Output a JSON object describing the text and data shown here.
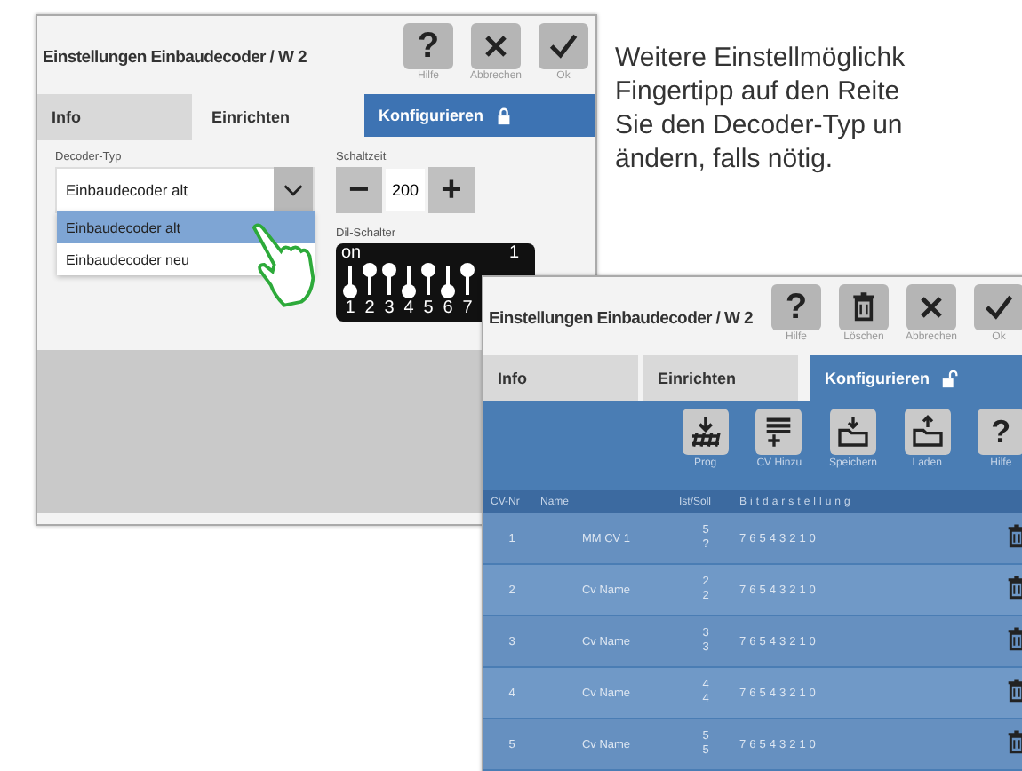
{
  "note": {
    "lines": [
      "Weitere Einstellmöglichk",
      "Fingertipp auf den Reite",
      "Sie den Decoder-Typ un",
      "ändern, falls nötig."
    ]
  },
  "settings_window": {
    "title": "Einstellungen Einbaudecoder / W 2",
    "actions": [
      {
        "kind": "help",
        "symbol": "?",
        "label": "Hilfe"
      },
      {
        "kind": "close",
        "label": "Abbrechen"
      },
      {
        "kind": "check",
        "label": "Ok"
      }
    ],
    "tabs": [
      {
        "label": "Info",
        "selected": false,
        "kind": "plain"
      },
      {
        "label": "Einrichten",
        "selected": true,
        "kind": "plain"
      },
      {
        "label": "Konfigurieren",
        "selected": false,
        "kind": "config",
        "locked": true
      }
    ],
    "decoder_type": {
      "label": "Decoder-Typ",
      "value": "Einbaudecoder alt",
      "expanded": true,
      "options": [
        {
          "label": "Einbaudecoder alt",
          "selected": true
        },
        {
          "label": "Einbaudecoder neu",
          "selected": false
        }
      ]
    },
    "switch_time": {
      "label": "Schaltzeit",
      "value": "200",
      "minus": "−",
      "plus": "+"
    },
    "dip_switch": {
      "label": "Dil-Schalter",
      "on_label": "on",
      "one_label": "1",
      "switches": [
        {
          "label": "1",
          "on": false
        },
        {
          "label": "2",
          "on": true
        },
        {
          "label": "3",
          "on": true
        },
        {
          "label": "4",
          "on": false
        },
        {
          "label": "5",
          "on": true
        },
        {
          "label": "6",
          "on": false
        },
        {
          "label": "7",
          "on": true
        }
      ]
    }
  },
  "config_window": {
    "title": "Einstellungen Einbaudecoder / W 2",
    "actions": [
      {
        "kind": "help",
        "symbol": "?",
        "label": "Hilfe"
      },
      {
        "kind": "trash",
        "label": "Löschen"
      },
      {
        "kind": "close",
        "label": "Abbrechen"
      },
      {
        "kind": "check",
        "label": "Ok"
      }
    ],
    "tabs": [
      {
        "label": "Info",
        "selected": false,
        "kind": "plain"
      },
      {
        "label": "Einrichten",
        "selected": false,
        "kind": "plain"
      },
      {
        "label": "Konfigurieren",
        "selected": true,
        "kind": "config",
        "locked": false
      }
    ],
    "toolbar": [
      {
        "kind": "prog",
        "label": "Prog"
      },
      {
        "kind": "add",
        "label": "CV Hinzu"
      },
      {
        "kind": "save",
        "label": "Speichern"
      },
      {
        "kind": "load",
        "label": "Laden"
      },
      {
        "kind": "help",
        "symbol": "?",
        "label": "Hilfe"
      }
    ],
    "columns": [
      "CV-Nr",
      "Name",
      "Ist/Soll",
      "Bitdarstellung"
    ],
    "rows": [
      {
        "cv": "1",
        "name": "MM CV 1",
        "ist": "5",
        "soll": "?",
        "bits": "76543210"
      },
      {
        "cv": "2",
        "name": "Cv Name",
        "ist": "2",
        "soll": "2",
        "bits": "76543210"
      },
      {
        "cv": "3",
        "name": "Cv Name",
        "ist": "3",
        "soll": "3",
        "bits": "76543210"
      },
      {
        "cv": "4",
        "name": "Cv Name",
        "ist": "4",
        "soll": "4",
        "bits": "76543210"
      },
      {
        "cv": "5",
        "name": "Cv Name",
        "ist": "5",
        "soll": "5",
        "bits": "76543210"
      }
    ]
  }
}
